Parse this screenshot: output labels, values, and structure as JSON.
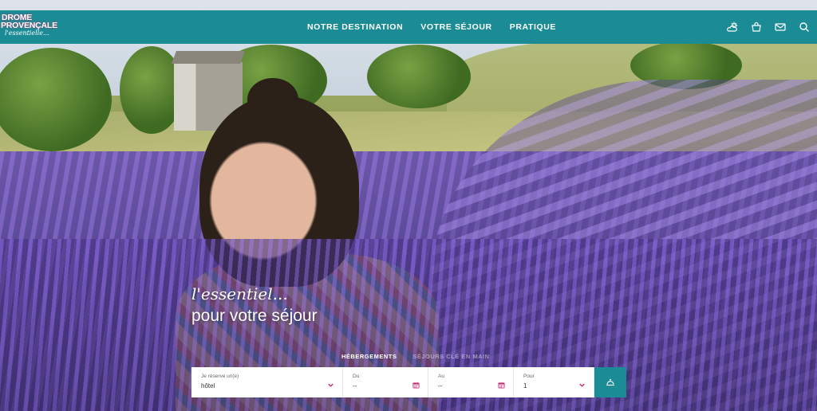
{
  "brand": {
    "logo_line1": "DROME",
    "logo_line2": "PROVENÇALE",
    "logo_tagline": "l'essentielle..."
  },
  "nav": {
    "items": [
      {
        "label": "NOTRE DESTINATION"
      },
      {
        "label": "VOTRE SÉJOUR"
      },
      {
        "label": "PRATIQUE"
      }
    ]
  },
  "header_icons": [
    "weather-icon",
    "basket-icon",
    "mail-icon",
    "search-icon"
  ],
  "hero": {
    "tagline_line1": "l'essentiel...",
    "tagline_line2": "pour votre séjour"
  },
  "search": {
    "tabs": [
      {
        "label": "HÉBERGEMENTS",
        "active": true
      },
      {
        "label": "SÉJOURS CLÉ EN MAIN",
        "active": false
      }
    ],
    "fields": {
      "type": {
        "label": "Je réserve un(e)",
        "value": "hôtel"
      },
      "du": {
        "label": "Du",
        "value": "--"
      },
      "au": {
        "label": "Au",
        "value": "--"
      },
      "pour": {
        "label": "Pour",
        "value": "1"
      }
    }
  },
  "colors": {
    "header_bg": "#1b8c96",
    "logo_accent": "#c0327a",
    "date_icon": "#c0327a"
  }
}
